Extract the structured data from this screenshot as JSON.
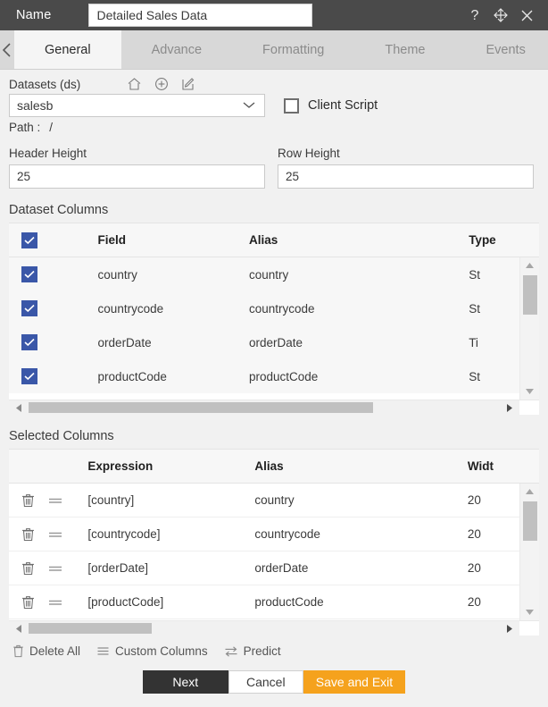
{
  "titlebar": {
    "name_label": "Name",
    "name_value": "Detailed Sales Data",
    "help_icon": "question-mark-icon",
    "move_icon": "move-icon",
    "close_icon": "close-icon"
  },
  "tabs": {
    "prev_icon": "chevron-left-icon",
    "next_icon": "chevron-right-icon",
    "items": [
      {
        "label": "General",
        "active": true
      },
      {
        "label": "Advance",
        "active": false
      },
      {
        "label": "Formatting",
        "active": false
      },
      {
        "label": "Theme",
        "active": false
      },
      {
        "label": "Events",
        "active": false
      }
    ]
  },
  "datasets": {
    "label": "Datasets (ds)",
    "home_icon": "home-icon",
    "add_icon": "plus-circle-icon",
    "edit_icon": "edit-pencil-icon",
    "selected": "salesb",
    "caret_icon": "chevron-down-icon",
    "client_script_label": "Client Script",
    "client_script_checked": false,
    "path_label": "Path :",
    "path_value": "/"
  },
  "sizes": {
    "header_height_label": "Header Height",
    "header_height_value": "25",
    "row_height_label": "Row Height",
    "row_height_value": "25"
  },
  "dataset_columns": {
    "title": "Dataset Columns",
    "header_checked": true,
    "headers": {
      "field": "Field",
      "alias": "Alias",
      "type": "Type"
    },
    "rows": [
      {
        "checked": true,
        "field": "country",
        "alias": "country",
        "type": "St"
      },
      {
        "checked": true,
        "field": "countrycode",
        "alias": "countrycode",
        "type": "St"
      },
      {
        "checked": true,
        "field": "orderDate",
        "alias": "orderDate",
        "type": "Ti"
      },
      {
        "checked": true,
        "field": "productCode",
        "alias": "productCode",
        "type": "St"
      }
    ]
  },
  "selected_columns": {
    "title": "Selected Columns",
    "headers": {
      "expression": "Expression",
      "alias": "Alias",
      "width": "Widt"
    },
    "delete_icon": "trash-icon",
    "drag_icon": "drag-handle-icon",
    "rows": [
      {
        "expression": "[country]",
        "alias": "country",
        "width": "20"
      },
      {
        "expression": "[countrycode]",
        "alias": "countrycode",
        "width": "20"
      },
      {
        "expression": "[orderDate]",
        "alias": "orderDate",
        "width": "20"
      },
      {
        "expression": "[productCode]",
        "alias": "productCode",
        "width": "20"
      }
    ]
  },
  "toolbar": {
    "delete_all_label": "Delete All",
    "delete_all_icon": "trash-icon",
    "custom_columns_label": "Custom Columns",
    "custom_columns_icon": "list-lines-icon",
    "predict_label": "Predict",
    "predict_icon": "swap-arrows-icon"
  },
  "footer": {
    "next_label": "Next",
    "cancel_label": "Cancel",
    "save_label": "Save and Exit"
  },
  "colors": {
    "titlebar_bg": "#4a4a4a",
    "tab_inactive_bg": "#d8d8d8",
    "tab_active_bg": "#f5f5f5",
    "checkbox_blue": "#3a57a8",
    "save_orange": "#f5a21d",
    "next_dark": "#333333"
  }
}
